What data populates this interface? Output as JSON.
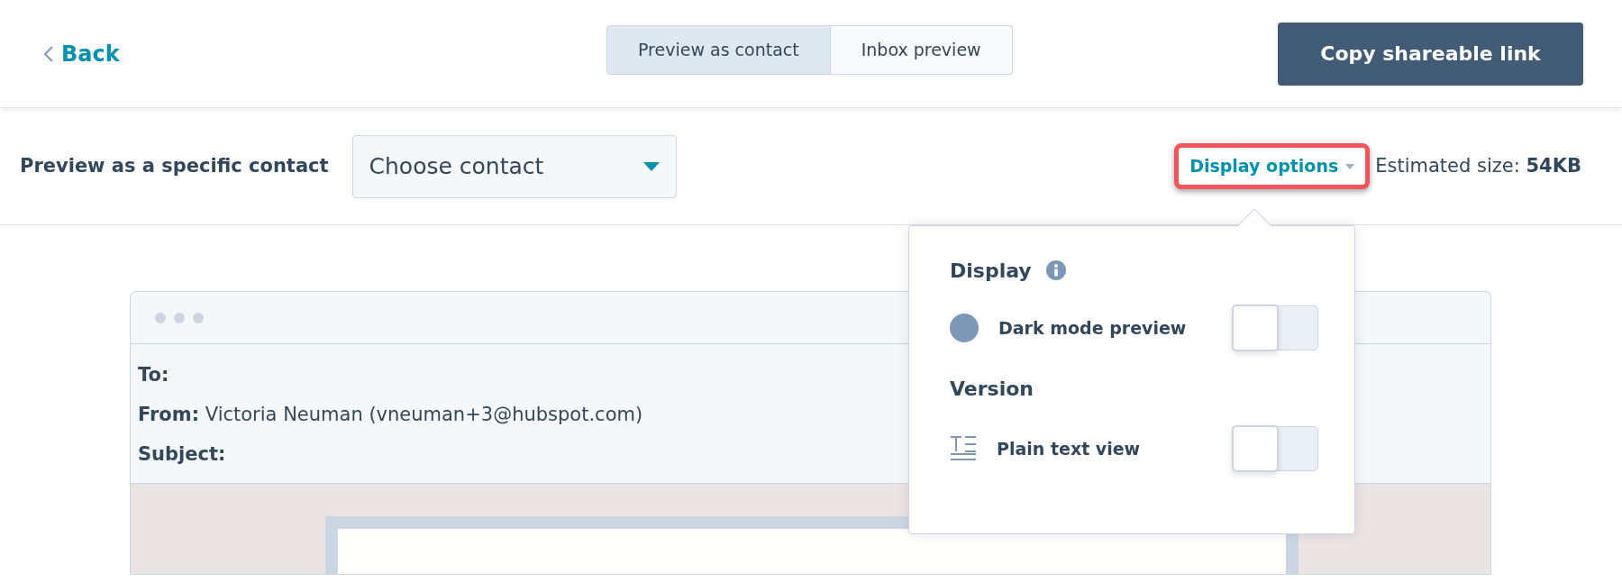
{
  "header": {
    "back": "Back",
    "tabs": [
      {
        "label": "Preview as contact",
        "selected": true
      },
      {
        "label": "Inbox preview",
        "selected": false
      }
    ],
    "copy_button": "Copy shareable link"
  },
  "toolbar": {
    "label": "Preview as a specific contact",
    "contact_select": {
      "value": "Choose contact"
    },
    "display_options": {
      "label": "Display options",
      "highlighted": true
    },
    "estimated_size": "Estimated size: **54KB**"
  },
  "email": {
    "fields": [
      {
        "label": "To:"
      },
      {
        "label": "From:",
        "value": "Victoria Neuman (vneuman+3@hubspot.com)"
      },
      {
        "label": "Subject:"
      }
    ]
  },
  "popover": {
    "sections": [
      {
        "title": "Display",
        "info": true,
        "options": [
          {
            "label": "Dark mode preview",
            "kind": "dark",
            "on": false
          }
        ]
      },
      {
        "title": "Version",
        "options": [
          {
            "label": "Plain text view",
            "kind": "plain",
            "on": false
          }
        ]
      }
    ]
  }
}
